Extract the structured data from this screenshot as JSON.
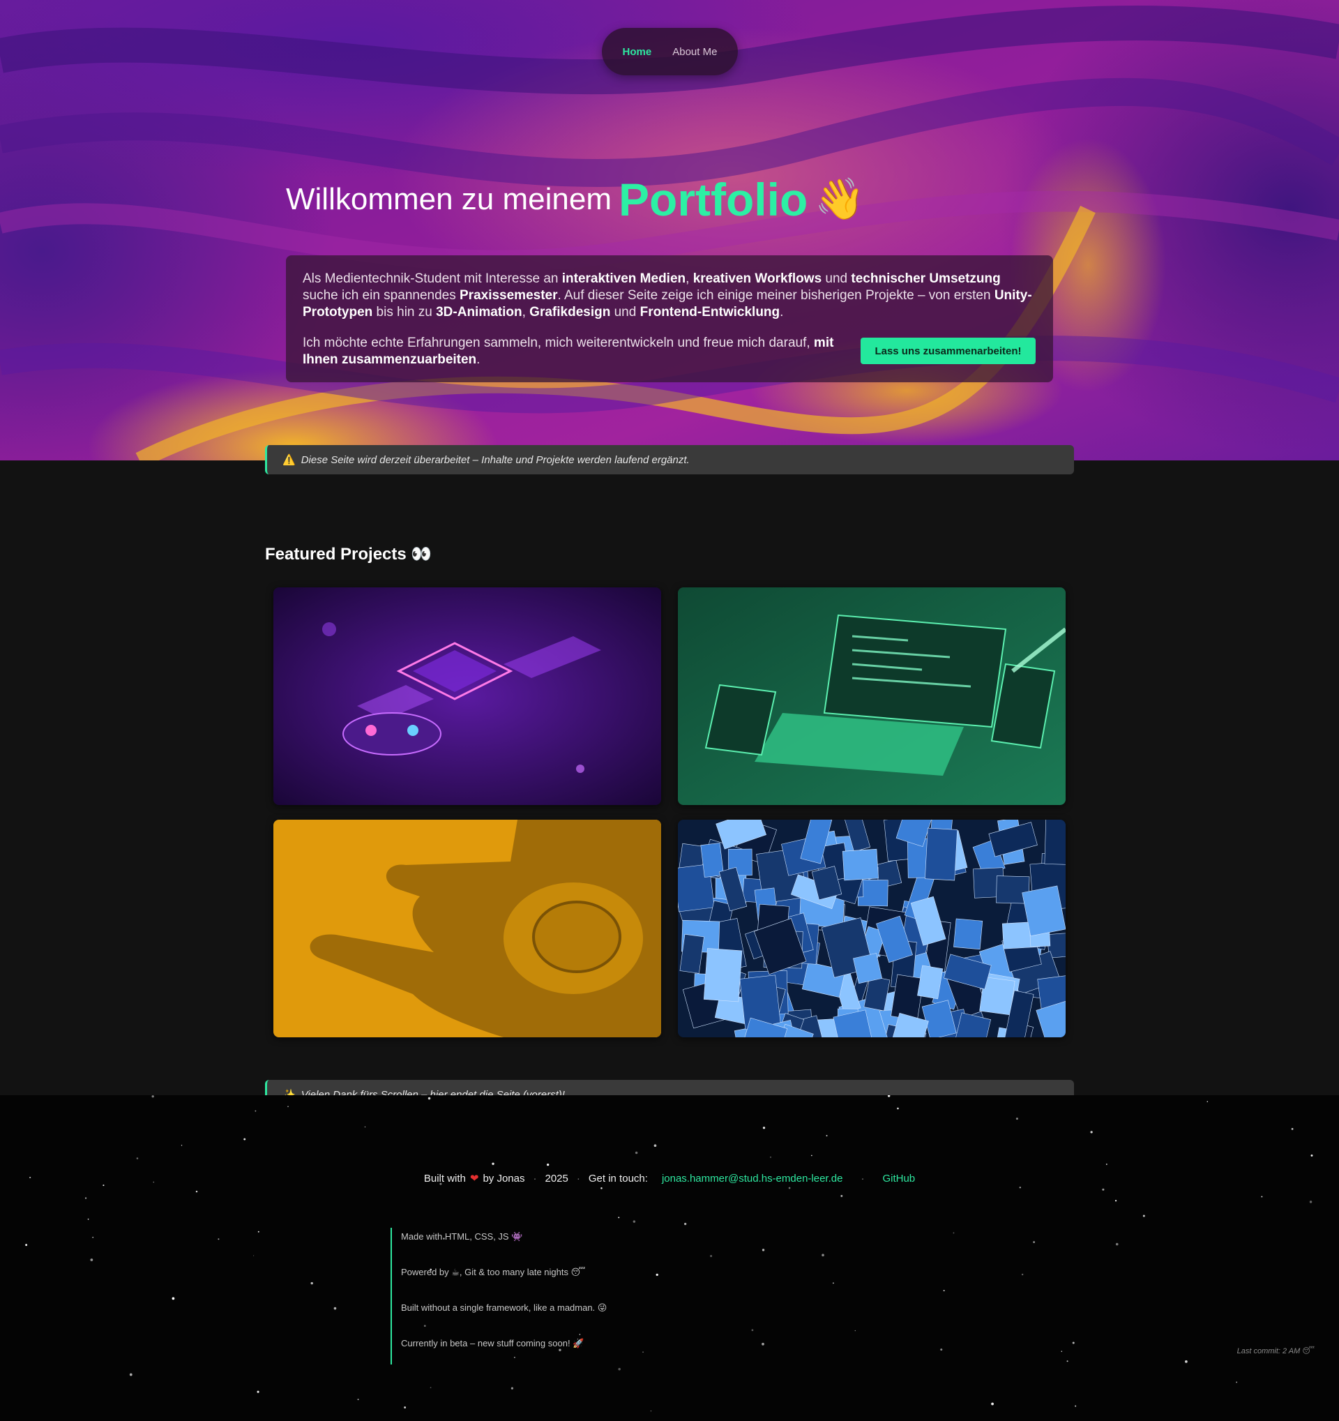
{
  "nav": {
    "home": "Home",
    "about": "About Me"
  },
  "hero": {
    "title_prefix": "Willkommen zu meinem",
    "title_accent": "Portfolio",
    "wave_emoji": "👋"
  },
  "intro": {
    "p1": [
      {
        "t": "Als Medientechnik-Student mit Interesse an ",
        "b": false
      },
      {
        "t": "interaktiven Medien",
        "b": true
      },
      {
        "t": ", ",
        "b": false
      },
      {
        "t": "kreativen Workflows",
        "b": true
      },
      {
        "t": " und ",
        "b": false
      },
      {
        "t": "technischer Umsetzung",
        "b": true
      },
      {
        "t": " suche ich ein spannendes ",
        "b": false
      },
      {
        "t": "Praxissemester",
        "b": true
      },
      {
        "t": ". Auf dieser Seite zeige ich einige meiner bisherigen Projekte – von ersten ",
        "b": false
      },
      {
        "t": "Unity-Prototypen",
        "b": true
      },
      {
        "t": " bis hin zu ",
        "b": false
      },
      {
        "t": "3D-Animation",
        "b": true
      },
      {
        "t": ", ",
        "b": false
      },
      {
        "t": "Grafikdesign",
        "b": true
      },
      {
        "t": " und ",
        "b": false
      },
      {
        "t": "Frontend-Entwicklung",
        "b": true
      },
      {
        "t": ".",
        "b": false
      }
    ],
    "p2": [
      {
        "t": "Ich möchte echte Erfahrungen sammeln, mich weiterentwickeln und freue mich darauf, ",
        "b": false
      },
      {
        "t": "mit Ihnen zusammenzuarbeiten",
        "b": true
      },
      {
        "t": ".",
        "b": false
      }
    ],
    "cta": "Lass uns zusammenarbeiten!"
  },
  "notice_top": {
    "icon": "⚠️",
    "text": "Diese Seite wird derzeit überarbeitet – Inhalte und Projekte werden laufend ergänzt."
  },
  "featured": {
    "title": "Featured Projects",
    "emoji": "👀"
  },
  "projects": [
    {
      "name": "game-controller-isometric-art",
      "accent": "#b050ff"
    },
    {
      "name": "laptop-code-isometric-art",
      "accent": "#2ed69a"
    },
    {
      "name": "blender-logo-3d",
      "accent": "#e39a10"
    },
    {
      "name": "movie-poster-collage",
      "accent": "#2a7ad8"
    }
  ],
  "notice_bottom": {
    "icon": "✨",
    "text": "Vielen Dank fürs Scrollen – hier endet die Seite (vorerst)!"
  },
  "footer": {
    "built_with": "Built with",
    "heart": "❤",
    "by": "by Jonas",
    "year": "2025",
    "get_in_touch": "Get in touch:",
    "email": "jonas.hammer@stud.hs-emden-leer.de",
    "github": "GitHub",
    "log": [
      "Made with HTML, CSS, JS 👾",
      "Powered by ☕, Git & too many late nights 😴",
      "Built without a single framework, like a madman. 😜",
      "Currently in beta – new stuff coming soon! 🚀"
    ],
    "last_commit": "Last commit: 2 AM 😴"
  }
}
